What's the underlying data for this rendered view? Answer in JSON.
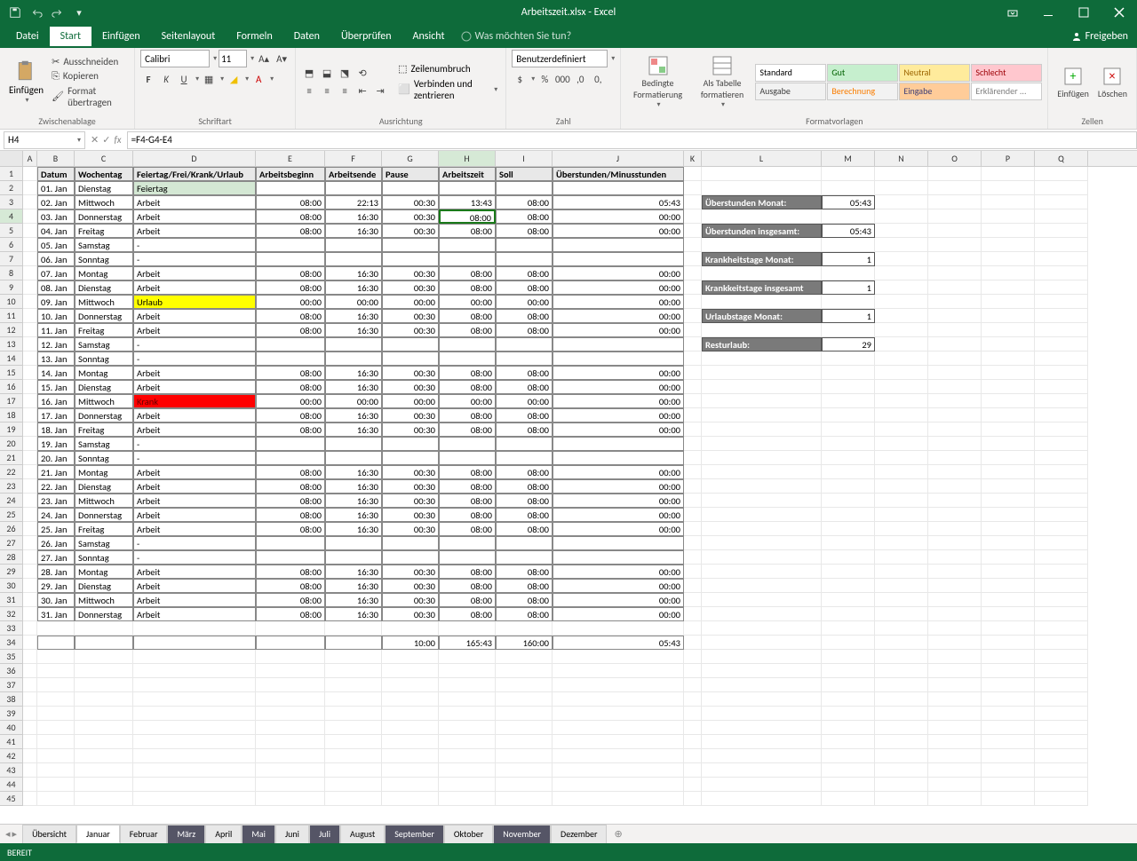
{
  "title": "Arbeitszeit.xlsx - Excel",
  "menu": {
    "datei": "Datei",
    "start": "Start",
    "einfuegen": "Einfügen",
    "seitenlayout": "Seitenlayout",
    "formeln": "Formeln",
    "daten": "Daten",
    "ueberpruefen": "Überprüfen",
    "ansicht": "Ansicht",
    "tellme": "Was möchten Sie tun?",
    "freigeben": "Freigeben"
  },
  "ribbon": {
    "clipboard": {
      "paste": "Einfügen",
      "cut": "Ausschneiden",
      "copy": "Kopieren",
      "format_painter": "Format übertragen",
      "label": "Zwischenablage"
    },
    "font": {
      "font": "Calibri",
      "size": "11",
      "label": "Schriftart"
    },
    "alignment": {
      "wrap": "Zeilenumbruch",
      "merge": "Verbinden und zentrieren",
      "label": "Ausrichtung"
    },
    "number": {
      "format": "Benutzerdefiniert",
      "label": "Zahl"
    },
    "styles": {
      "cond": "Bedingte Formatierung",
      "table": "Als Tabelle formatieren",
      "label": "Formatvorlagen",
      "cells": [
        {
          "t": "Standard",
          "bg": "#fff",
          "c": "#000"
        },
        {
          "t": "Gut",
          "bg": "#c6efce",
          "c": "#006100"
        },
        {
          "t": "Neutral",
          "bg": "#ffeb9c",
          "c": "#9c6500"
        },
        {
          "t": "Schlecht",
          "bg": "#ffc7ce",
          "c": "#9c0006"
        },
        {
          "t": "Ausgabe",
          "bg": "#f2f2f2",
          "c": "#3f3f3f"
        },
        {
          "t": "Berechnung",
          "bg": "#f2f2f2",
          "c": "#fa7d00"
        },
        {
          "t": "Eingabe",
          "bg": "#ffcc99",
          "c": "#3f3f76"
        },
        {
          "t": "Erklärender ...",
          "bg": "#fff",
          "c": "#7f7f7f"
        }
      ]
    },
    "cells": {
      "insert": "Einfügen",
      "delete": "Löschen",
      "label": "Zellen"
    }
  },
  "namebox": "H4",
  "formula": "=F4-G4-E4",
  "headers": [
    "Datum",
    "Wochentag",
    "Feiertag/Frei/Krank/Urlaub",
    "Arbeitsbeginn",
    "Arbeitsende",
    "Pause",
    "Arbeitszeit",
    "Soll",
    "Überstunden/Minusstunden"
  ],
  "rows": [
    {
      "d": "01. Jan",
      "w": "Dienstag",
      "s": "Feiertag",
      "cls": "feiertag"
    },
    {
      "d": "02. Jan",
      "w": "Mittwoch",
      "s": "Arbeit",
      "b": "08:00",
      "e": "22:13",
      "p": "00:30",
      "a": "13:43",
      "so": "08:00",
      "u": "05:43"
    },
    {
      "d": "03. Jan",
      "w": "Donnerstag",
      "s": "Arbeit",
      "b": "08:00",
      "e": "16:30",
      "p": "00:30",
      "a": "08:00",
      "so": "08:00",
      "u": "00:00"
    },
    {
      "d": "04. Jan",
      "w": "Freitag",
      "s": "Arbeit",
      "b": "08:00",
      "e": "16:30",
      "p": "00:30",
      "a": "08:00",
      "so": "08:00",
      "u": "00:00"
    },
    {
      "d": "05. Jan",
      "w": "Samstag",
      "s": "-"
    },
    {
      "d": "06. Jan",
      "w": "Sonntag",
      "s": "-"
    },
    {
      "d": "07. Jan",
      "w": "Montag",
      "s": "Arbeit",
      "b": "08:00",
      "e": "16:30",
      "p": "00:30",
      "a": "08:00",
      "so": "08:00",
      "u": "00:00"
    },
    {
      "d": "08. Jan",
      "w": "Dienstag",
      "s": "Arbeit",
      "b": "08:00",
      "e": "16:30",
      "p": "00:30",
      "a": "08:00",
      "so": "08:00",
      "u": "00:00"
    },
    {
      "d": "09. Jan",
      "w": "Mittwoch",
      "s": "Urlaub",
      "cls": "urlaub",
      "b": "00:00",
      "e": "00:00",
      "p": "00:00",
      "a": "00:00",
      "so": "00:00",
      "u": "00:00"
    },
    {
      "d": "10. Jan",
      "w": "Donnerstag",
      "s": "Arbeit",
      "b": "08:00",
      "e": "16:30",
      "p": "00:30",
      "a": "08:00",
      "so": "08:00",
      "u": "00:00"
    },
    {
      "d": "11. Jan",
      "w": "Freitag",
      "s": "Arbeit",
      "b": "08:00",
      "e": "16:30",
      "p": "00:30",
      "a": "08:00",
      "so": "08:00",
      "u": "00:00"
    },
    {
      "d": "12. Jan",
      "w": "Samstag",
      "s": "-"
    },
    {
      "d": "13. Jan",
      "w": "Sonntag",
      "s": "-"
    },
    {
      "d": "14. Jan",
      "w": "Montag",
      "s": "Arbeit",
      "b": "08:00",
      "e": "16:30",
      "p": "00:30",
      "a": "08:00",
      "so": "08:00",
      "u": "00:00"
    },
    {
      "d": "15. Jan",
      "w": "Dienstag",
      "s": "Arbeit",
      "b": "08:00",
      "e": "16:30",
      "p": "00:30",
      "a": "08:00",
      "so": "08:00",
      "u": "00:00"
    },
    {
      "d": "16. Jan",
      "w": "Mittwoch",
      "s": "Krank",
      "cls": "krank",
      "b": "00:00",
      "e": "00:00",
      "p": "00:00",
      "a": "00:00",
      "so": "00:00",
      "u": "00:00"
    },
    {
      "d": "17. Jan",
      "w": "Donnerstag",
      "s": "Arbeit",
      "b": "08:00",
      "e": "16:30",
      "p": "00:30",
      "a": "08:00",
      "so": "08:00",
      "u": "00:00"
    },
    {
      "d": "18. Jan",
      "w": "Freitag",
      "s": "Arbeit",
      "b": "08:00",
      "e": "16:30",
      "p": "00:30",
      "a": "08:00",
      "so": "08:00",
      "u": "00:00"
    },
    {
      "d": "19. Jan",
      "w": "Samstag",
      "s": "-"
    },
    {
      "d": "20. Jan",
      "w": "Sonntag",
      "s": "-"
    },
    {
      "d": "21. Jan",
      "w": "Montag",
      "s": "Arbeit",
      "b": "08:00",
      "e": "16:30",
      "p": "00:30",
      "a": "08:00",
      "so": "08:00",
      "u": "00:00"
    },
    {
      "d": "22. Jan",
      "w": "Dienstag",
      "s": "Arbeit",
      "b": "08:00",
      "e": "16:30",
      "p": "00:30",
      "a": "08:00",
      "so": "08:00",
      "u": "00:00"
    },
    {
      "d": "23. Jan",
      "w": "Mittwoch",
      "s": "Arbeit",
      "b": "08:00",
      "e": "16:30",
      "p": "00:30",
      "a": "08:00",
      "so": "08:00",
      "u": "00:00"
    },
    {
      "d": "24. Jan",
      "w": "Donnerstag",
      "s": "Arbeit",
      "b": "08:00",
      "e": "16:30",
      "p": "00:30",
      "a": "08:00",
      "so": "08:00",
      "u": "00:00"
    },
    {
      "d": "25. Jan",
      "w": "Freitag",
      "s": "Arbeit",
      "b": "08:00",
      "e": "16:30",
      "p": "00:30",
      "a": "08:00",
      "so": "08:00",
      "u": "00:00"
    },
    {
      "d": "26. Jan",
      "w": "Samstag",
      "s": "-"
    },
    {
      "d": "27. Jan",
      "w": "Sonntag",
      "s": "-"
    },
    {
      "d": "28. Jan",
      "w": "Montag",
      "s": "Arbeit",
      "b": "08:00",
      "e": "16:30",
      "p": "00:30",
      "a": "08:00",
      "so": "08:00",
      "u": "00:00"
    },
    {
      "d": "29. Jan",
      "w": "Dienstag",
      "s": "Arbeit",
      "b": "08:00",
      "e": "16:30",
      "p": "00:30",
      "a": "08:00",
      "so": "08:00",
      "u": "00:00"
    },
    {
      "d": "30. Jan",
      "w": "Mittwoch",
      "s": "Arbeit",
      "b": "08:00",
      "e": "16:30",
      "p": "00:30",
      "a": "08:00",
      "so": "08:00",
      "u": "00:00"
    },
    {
      "d": "31. Jan",
      "w": "Donnerstag",
      "s": "Arbeit",
      "b": "08:00",
      "e": "16:30",
      "p": "00:30",
      "a": "08:00",
      "so": "08:00",
      "u": "00:00"
    }
  ],
  "totals": {
    "pause": "10:00",
    "arbeit": "165:43",
    "soll": "160:00",
    "ueber": "05:43"
  },
  "summary": [
    {
      "l": "Überstunden Monat:",
      "v": "05:43"
    },
    {
      "l": "Überstunden insgesamt:",
      "v": "05:43"
    },
    {
      "l": "Krankheitstage Monat:",
      "v": "1"
    },
    {
      "l": "Krankkeitstage insgesamt",
      "v": "1"
    },
    {
      "l": "Urlaubstage Monat:",
      "v": "1"
    },
    {
      "l": "Resturlaub:",
      "v": "29"
    }
  ],
  "summary_rows": [
    3,
    5,
    7,
    9,
    11,
    13
  ],
  "tabs": [
    "Übersicht",
    "Januar",
    "Februar",
    "März",
    "April",
    "Mai",
    "Juni",
    "Juli",
    "August",
    "September",
    "Oktober",
    "November",
    "Dezember"
  ],
  "active_tab": "Januar",
  "dark_tabs": [
    "März",
    "Mai",
    "Juli",
    "September",
    "November"
  ],
  "status": "BEREIT",
  "cols": [
    "A",
    "B",
    "C",
    "D",
    "E",
    "F",
    "G",
    "H",
    "I",
    "J",
    "K",
    "L",
    "M",
    "N",
    "O",
    "P",
    "Q"
  ],
  "selected_row_index": 3
}
